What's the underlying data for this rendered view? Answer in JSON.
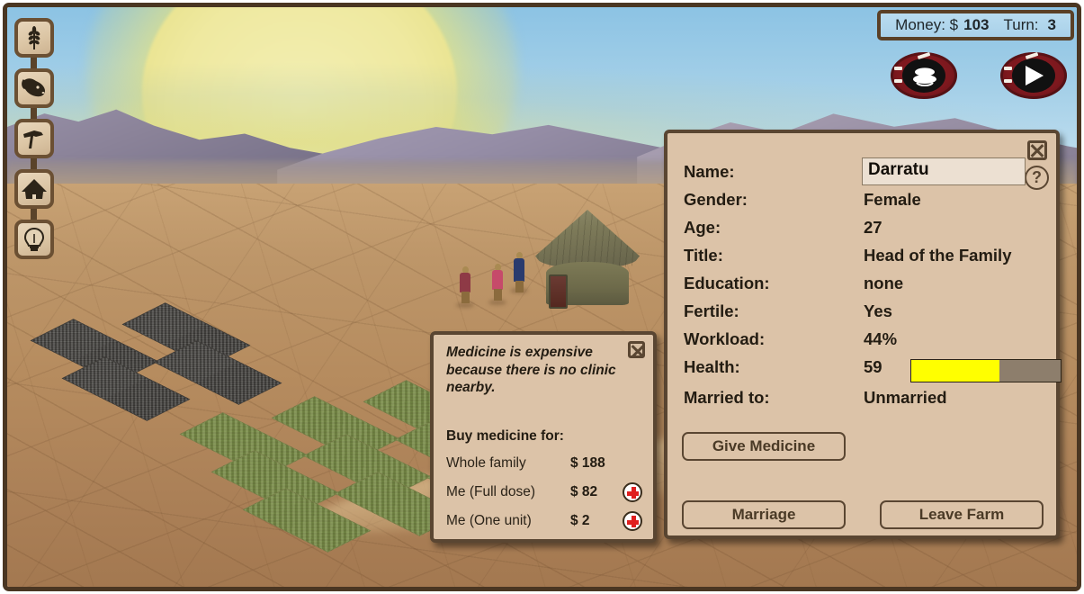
{
  "status_bar": {
    "money_label": "Money: $",
    "money_value": "103",
    "turn_label": "Turn:",
    "turn_value": "3"
  },
  "sidebar": {
    "items": [
      {
        "name": "crops-button",
        "icon": "wheat-icon"
      },
      {
        "name": "livestock-button",
        "icon": "cow-head-icon"
      },
      {
        "name": "tools-button",
        "icon": "hammer-icon"
      },
      {
        "name": "buildings-button",
        "icon": "hut-icon"
      },
      {
        "name": "ideas-button",
        "icon": "lightbulb-icon"
      }
    ]
  },
  "top_buttons": [
    {
      "name": "market-button",
      "icon": "stacked-discs-icon"
    },
    {
      "name": "end-turn-button",
      "icon": "play-triangle-icon"
    }
  ],
  "character_panel": {
    "close_label": "",
    "help_label": "?",
    "rows": [
      {
        "label": "Name:",
        "value": "Darratu"
      },
      {
        "label": "Gender:",
        "value": "Female"
      },
      {
        "label": "Age:",
        "value": "27"
      },
      {
        "label": "Title:",
        "value": "Head of the Family"
      },
      {
        "label": "Education:",
        "value": "none"
      },
      {
        "label": "Fertile:",
        "value": "Yes"
      },
      {
        "label": "Workload:",
        "value": "44%"
      },
      {
        "label": "Health:",
        "value": "59"
      },
      {
        "label": "Married to:",
        "value": "Unmarried"
      }
    ],
    "health_percent": 59,
    "health_fill_color": "#ffff00",
    "health_track_color": "#8d7e6c",
    "buttons": {
      "give_medicine": "Give Medicine",
      "marriage": "Marriage",
      "leave_farm": "Leave Farm"
    }
  },
  "medicine_panel": {
    "note": "Medicine is expensive because there is no clinic nearby.",
    "heading": "Buy medicine for:",
    "options": [
      {
        "label": "Whole family",
        "price": "$ 188",
        "has_buy_button": false
      },
      {
        "label": "Me (Full dose)",
        "price": "$ 82",
        "has_buy_button": true
      },
      {
        "label": "Me (One unit)",
        "price": "$ 2",
        "has_buy_button": true
      }
    ]
  },
  "scene": {
    "people": [
      {
        "name": "villager-red",
        "robe_color": "#8e3a46"
      },
      {
        "name": "villager-pink",
        "robe_color": "#c64a6a"
      },
      {
        "name": "villager-blue",
        "robe_color": "#2a3b6e"
      }
    ],
    "plots": {
      "tilled_count": 4,
      "crop_count": 9,
      "tilled_color": "#4d4b47",
      "crop_color": "#7c8c4a"
    }
  },
  "theme": {
    "panel_bg": "#dcc3a8",
    "panel_border": "#5a4632",
    "status_bg": "#b0d6ec",
    "accent_red": "#8e1d23"
  }
}
